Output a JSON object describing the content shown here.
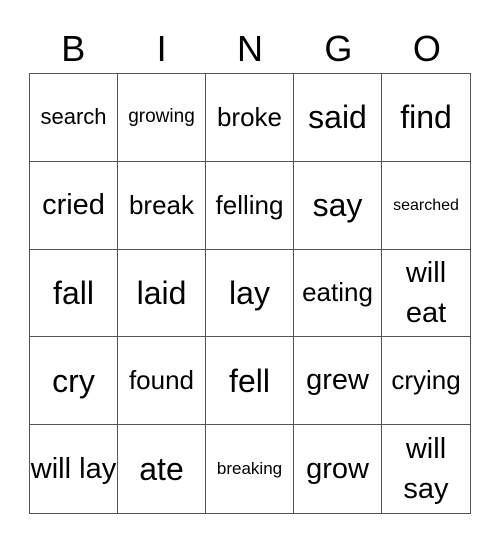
{
  "header": [
    "B",
    "I",
    "N",
    "G",
    "O"
  ],
  "rows": [
    [
      "search",
      "growing",
      "broke",
      "said",
      "find"
    ],
    [
      "cried",
      "break",
      "felling",
      "say",
      "searched"
    ],
    [
      "fall",
      "laid",
      "lay",
      "eating",
      "will eat"
    ],
    [
      "cry",
      "found",
      "fell",
      "grew",
      "crying"
    ],
    [
      "will lay",
      "ate",
      "breaking",
      "grow",
      "will say"
    ]
  ]
}
